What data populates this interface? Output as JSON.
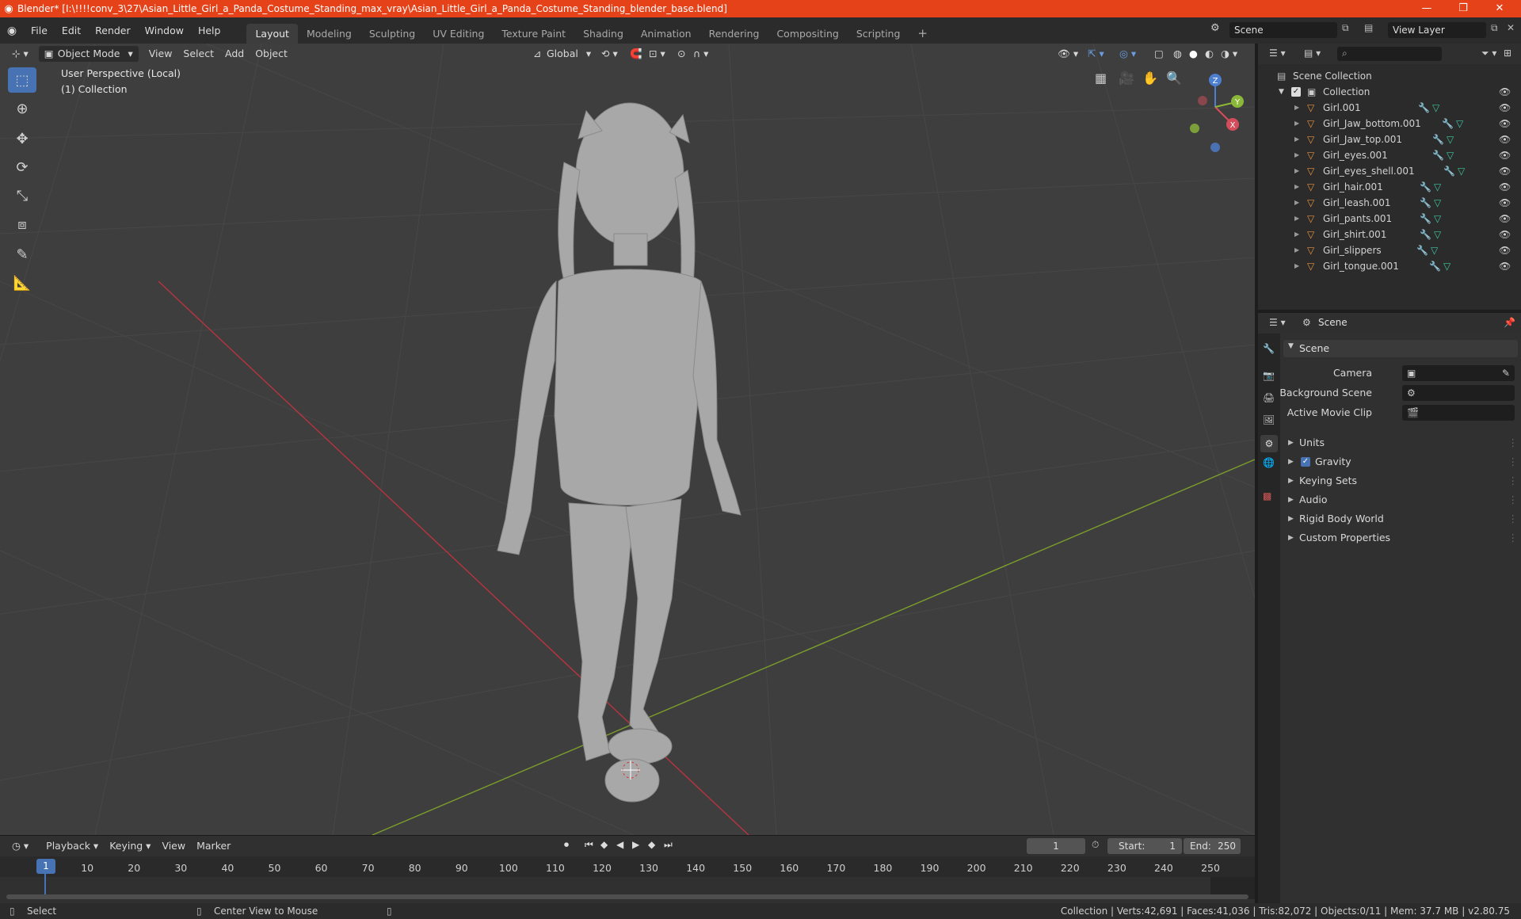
{
  "window": {
    "title": "Blender* [I:\\!!!!conv_3\\27\\Asian_Little_Girl_a_Panda_Costume_Standing_max_vray\\Asian_Little_Girl_a_Panda_Costume_Standing_blender_base.blend]",
    "controls": [
      "—",
      "❐",
      "✕"
    ]
  },
  "menubar": {
    "menus": [
      "File",
      "Edit",
      "Render",
      "Window",
      "Help"
    ],
    "workspaces": [
      "Layout",
      "Modeling",
      "Sculpting",
      "UV Editing",
      "Texture Paint",
      "Shading",
      "Animation",
      "Rendering",
      "Compositing",
      "Scripting"
    ],
    "active_workspace": "Layout",
    "add_tab": "+",
    "scene_value": "Scene",
    "view_layer_value": "View Layer"
  },
  "viewport": {
    "mode": "Object Mode",
    "menus": [
      "View",
      "Select",
      "Add",
      "Object"
    ],
    "orientation": "Global",
    "overlay_line1": "User Perspective (Local)",
    "overlay_line2": "(1) Collection",
    "gizmo_axes": {
      "x": "X",
      "y": "Y",
      "z": "Z"
    }
  },
  "outliner": {
    "root": "Scene Collection",
    "collection": "Collection",
    "objects": [
      "Girl.001",
      "Girl_Jaw_bottom.001",
      "Girl_Jaw_top.001",
      "Girl_eyes.001",
      "Girl_eyes_shell.001",
      "Girl_hair.001",
      "Girl_leash.001",
      "Girl_pants.001",
      "Girl_shirt.001",
      "Girl_slippers",
      "Girl_tongue.001"
    ]
  },
  "properties": {
    "context": "Scene",
    "panel_title": "Scene",
    "fields": [
      {
        "label": "Camera",
        "value": ""
      },
      {
        "label": "Background Scene",
        "value": ""
      },
      {
        "label": "Active Movie Clip",
        "value": ""
      }
    ],
    "sections": [
      "Units",
      "Gravity",
      "Keying Sets",
      "Audio",
      "Rigid Body World",
      "Custom Properties"
    ],
    "gravity_checked": true
  },
  "timeline": {
    "menus": [
      "Playback",
      "Keying",
      "View",
      "Marker"
    ],
    "current_frame": "1",
    "start_label": "Start:",
    "start_value": "1",
    "end_label": "End:",
    "end_value": "250",
    "ticks": [
      "1",
      "10",
      "20",
      "30",
      "40",
      "50",
      "60",
      "70",
      "80",
      "90",
      "100",
      "110",
      "120",
      "130",
      "140",
      "150",
      "160",
      "170",
      "180",
      "190",
      "200",
      "210",
      "220",
      "230",
      "240",
      "250"
    ]
  },
  "statusbar": {
    "left_action": "Select",
    "middle_action": "Center View to Mouse",
    "stats": "Collection | Verts:42,691 | Faces:41,036 | Tris:82,072 | Objects:0/11 | Mem: 37.7 MB | v2.80.75"
  },
  "colors": {
    "title_bar": "#e5421a",
    "accent": "#4772b3",
    "x_axis": "#b8343f",
    "y_axis": "#7c9e2b",
    "mesh_icon": "#e8913c"
  }
}
